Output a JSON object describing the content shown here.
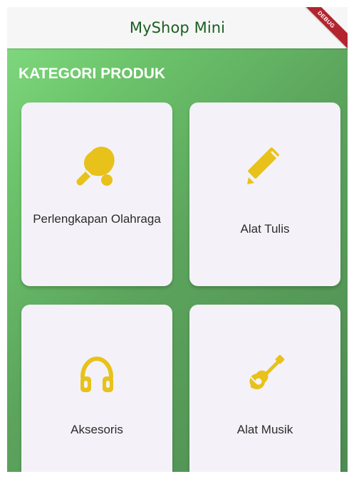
{
  "app": {
    "title": "MyShop Mini",
    "debug_label": "DEBUG"
  },
  "section": {
    "title": "KATEGORI PRODUK"
  },
  "categories": [
    {
      "label": "Perlengkapan Olahraga",
      "icon": "ping-pong-icon"
    },
    {
      "label": "Alat Tulis",
      "icon": "pencil-icon"
    },
    {
      "label": "Aksesoris",
      "icon": "headphones-icon"
    },
    {
      "label": "Alat Musik",
      "icon": "guitar-icon"
    }
  ],
  "colors": {
    "icon": "#e8c21a",
    "card_background": "#f4f2f8",
    "app_title": "#1b5e20",
    "background_top": "#7ed77d",
    "background_bottom": "#4e8b52",
    "debug_banner": "#b3242f"
  }
}
